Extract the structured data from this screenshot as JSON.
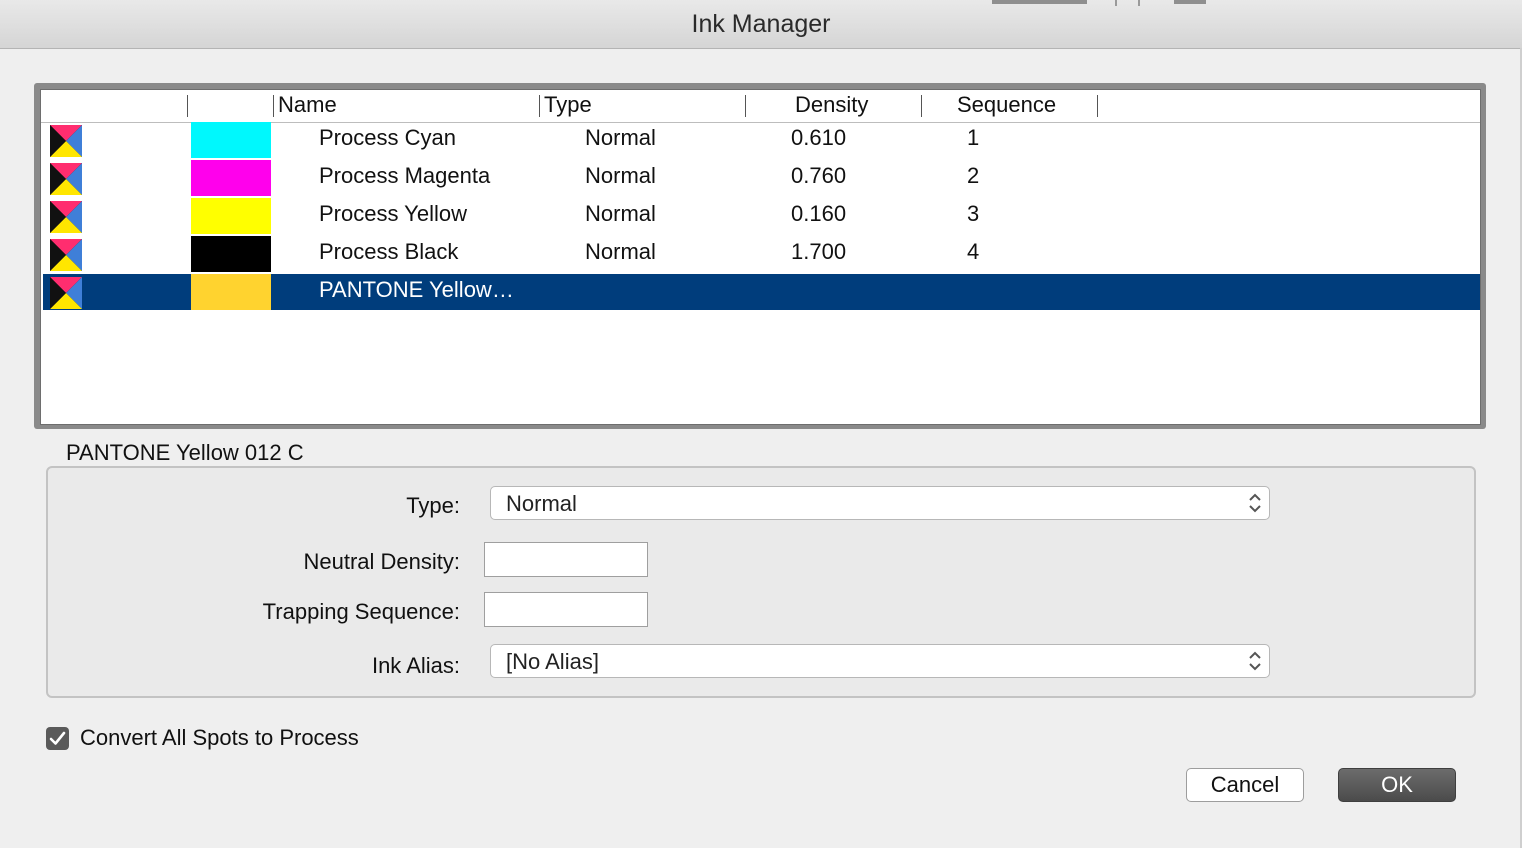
{
  "window": {
    "title": "Ink Manager"
  },
  "ink_list": {
    "columns": [
      "Name",
      "Type",
      "Density",
      "Sequence"
    ],
    "rows": [
      {
        "name": "Process Cyan",
        "type": "Normal",
        "density": "0.610",
        "sequence": "1",
        "swatch_color": "#00f8fd",
        "icon": "process-ink-icon"
      },
      {
        "name": "Process Magenta",
        "type": "Normal",
        "density": "0.760",
        "sequence": "2",
        "swatch_color": "#ff00ec",
        "icon": "process-ink-icon"
      },
      {
        "name": "Process Yellow",
        "type": "Normal",
        "density": "0.160",
        "sequence": "3",
        "swatch_color": "#ffff00",
        "icon": "process-ink-icon"
      },
      {
        "name": "Process Black",
        "type": "Normal",
        "density": "1.700",
        "sequence": "4",
        "swatch_color": "#000000",
        "icon": "process-ink-icon"
      },
      {
        "name": "PANTONE Yellow…",
        "type": "",
        "density": "",
        "sequence": "",
        "swatch_color": "#ffd32f",
        "icon": "spot-ink-icon",
        "selected": true
      }
    ],
    "selection_color": "#003d7c"
  },
  "settings": {
    "selected_ink_name": "PANTONE Yellow 012 C",
    "type_label": "Type:",
    "type_value": "Normal",
    "neutral_density_label": "Neutral Density:",
    "neutral_density_value": "",
    "trapping_sequence_label": "Trapping Sequence:",
    "trapping_sequence_value": "",
    "ink_alias_label": "Ink Alias:",
    "ink_alias_value": "[No Alias]"
  },
  "convert_all_spots": {
    "label": "Convert All Spots to Process",
    "checked": true
  },
  "buttons": {
    "cancel": "Cancel",
    "ok": "OK"
  }
}
